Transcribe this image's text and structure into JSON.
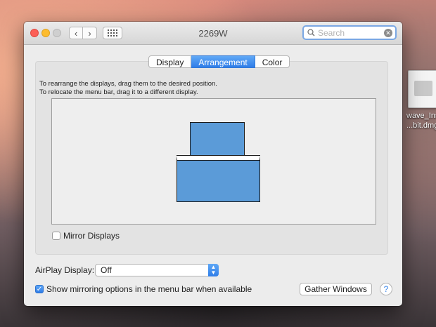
{
  "desktop": {
    "file_line1": "wave_Ins",
    "file_line2": "...bit.dmg"
  },
  "window": {
    "title": "2269W"
  },
  "toolbar": {
    "back_glyph": "‹",
    "forward_glyph": "›",
    "grid_icon": "show-all-grid-icon"
  },
  "search": {
    "placeholder": "Search"
  },
  "tabs": [
    {
      "label": "Display"
    },
    {
      "label": "Arrangement",
      "active": true
    },
    {
      "label": "Color"
    }
  ],
  "arrangement": {
    "instruction_1": "To rearrange the displays, drag them to the desired position.",
    "instruction_2": "To relocate the menu bar, drag it to a different display.",
    "mirror_label": "Mirror Displays",
    "mirror_checked": false
  },
  "airplay": {
    "label": "AirPlay Display:",
    "value": "Off"
  },
  "show_mirroring": {
    "label": "Show mirroring options in the menu bar when available",
    "checked": true
  },
  "buttons": {
    "gather": "Gather Windows",
    "help": "?"
  },
  "colors": {
    "accent": "#2f7de8",
    "display_fill": "#5b9bd8"
  }
}
